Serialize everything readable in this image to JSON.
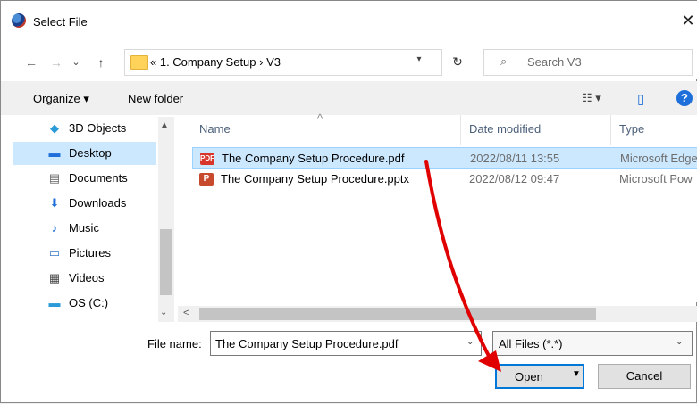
{
  "window": {
    "title": "Select File",
    "close_glyph": "✕"
  },
  "nav": {
    "back_glyph": "←",
    "forward_glyph": "→",
    "recent_glyph": "⌄",
    "up_glyph": "↑",
    "address": "« 1. Company Setup  ›  V3",
    "address_dropdown_glyph": "▾",
    "refresh_glyph": "↻",
    "search_icon_glyph": "⌕",
    "search_placeholder": "Search V3"
  },
  "toolbar": {
    "organize_label": "Organize ▾",
    "new_folder_label": "New folder",
    "view_glyph": "☷ ▾",
    "preview_glyph": "▯",
    "help_glyph": "?"
  },
  "sidebar": {
    "items": [
      {
        "label": "3D Objects",
        "icon": "cube-icon",
        "glyph": "◆",
        "color": "#2a9bd8"
      },
      {
        "label": "Desktop",
        "icon": "desktop-icon",
        "glyph": "▬",
        "color": "#1e6fd9",
        "selected": true
      },
      {
        "label": "Documents",
        "icon": "documents-icon",
        "glyph": "▤",
        "color": "#666666"
      },
      {
        "label": "Downloads",
        "icon": "download-icon",
        "glyph": "⬇",
        "color": "#1e6fd9"
      },
      {
        "label": "Music",
        "icon": "music-icon",
        "glyph": "♪",
        "color": "#1e6fd9"
      },
      {
        "label": "Pictures",
        "icon": "pictures-icon",
        "glyph": "▭",
        "color": "#3a78c4"
      },
      {
        "label": "Videos",
        "icon": "video-icon",
        "glyph": "▦",
        "color": "#444444"
      },
      {
        "label": "OS (C:)",
        "icon": "drive-icon",
        "glyph": "▬",
        "color": "#2a9bd8"
      }
    ],
    "scroll_up_glyph": "▲",
    "scroll_down_glyph": "⌄"
  },
  "files": {
    "columns": {
      "name": "Name",
      "date": "Date modified",
      "type": "Type",
      "sort_glyph": "^"
    },
    "rows": [
      {
        "name": "The Company Setup Procedure.pdf",
        "date": "2022/08/11 13:55",
        "type": "Microsoft Edge",
        "icon_label": "PDF",
        "icon_color": "#d9362b",
        "selected": true
      },
      {
        "name": "The Company Setup Procedure.pptx",
        "date": "2022/08/12 09:47",
        "type": "Microsoft Pow",
        "icon_label": "P",
        "icon_color": "#c84a2d"
      }
    ],
    "hscroll_left_glyph": "<"
  },
  "footer": {
    "filename_label": "File name:",
    "filename_value": "The Company Setup Procedure.pdf",
    "filename_dd_glyph": "⌄",
    "filter_value": "All Files (*.*)",
    "filter_dd_glyph": "⌄",
    "open_label": "Open",
    "open_dd_glyph": "▼",
    "cancel_label": "Cancel"
  },
  "colors": {
    "accent": "#0078d7",
    "selection": "#cce8ff",
    "annotation_arrow": "#e00000"
  }
}
